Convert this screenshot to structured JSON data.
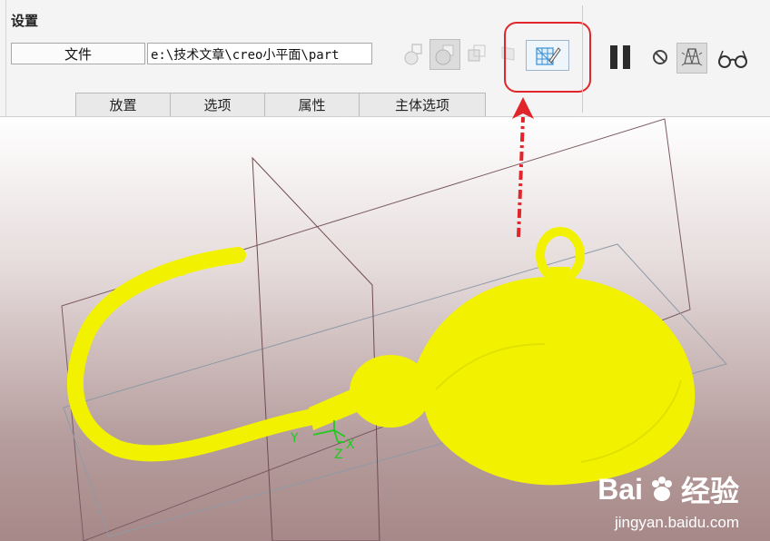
{
  "ribbon": {
    "group_title": "设置",
    "file_button_label": "文件",
    "path_value": "e:\\技术文章\\creo小平面\\part",
    "tabs": [
      "放置",
      "选项",
      "属性",
      "主体选项"
    ]
  },
  "icons": {
    "toolbar": [
      "sphere-view-icon",
      "shaded-sphere-icon",
      "cube-view-icon",
      "flag-icon",
      "mesh-edit-icon"
    ],
    "controls": [
      "pause-icon",
      "no-entry-icon",
      "mesh-preview-icon",
      "glasses-icon"
    ]
  },
  "viewport": {
    "axes": {
      "x": "X",
      "y": "Y",
      "z": "Z"
    },
    "model_color": "#f2f200",
    "triad_color": "#1ecb1e",
    "arrow_color": "#e0262a"
  },
  "watermark": {
    "logo_a": "Bai",
    "logo_b": "经验",
    "site": "jingyan.baidu.com"
  }
}
